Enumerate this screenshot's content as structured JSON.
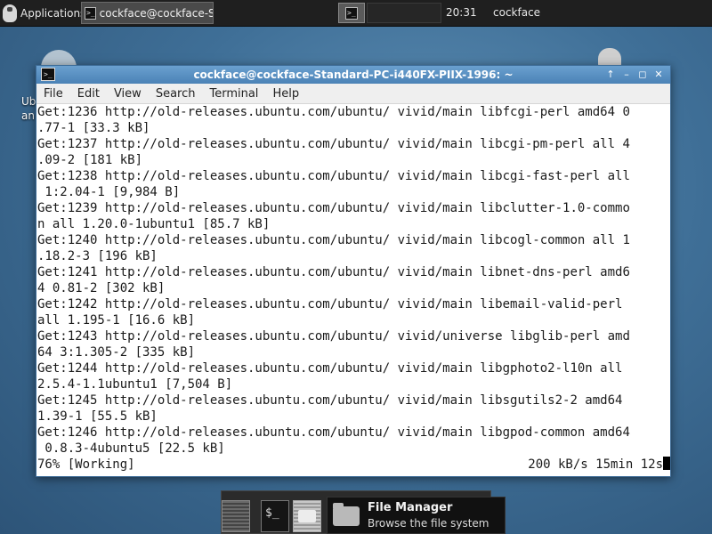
{
  "top_panel": {
    "applications_label": "Applications",
    "task_label": "cockface@cockface-Sta...",
    "clock": "20:31",
    "user": "cockface"
  },
  "desktop": {
    "home_label": "Ub\nan",
    "trash_icon": "trash-icon"
  },
  "window": {
    "title": "cockface@cockface-Standard-PC-i440FX-PIIX-1996: ~",
    "controls": [
      "↑",
      "–",
      "◻",
      "✕"
    ],
    "menu": [
      "File",
      "Edit",
      "View",
      "Search",
      "Terminal",
      "Help"
    ]
  },
  "terminal": {
    "lines": [
      "Get:1236 http://old-releases.ubuntu.com/ubuntu/ vivid/main libfcgi-perl amd64 0",
      ".77-1 [33.3 kB]",
      "Get:1237 http://old-releases.ubuntu.com/ubuntu/ vivid/main libcgi-pm-perl all 4",
      ".09-2 [181 kB]",
      "Get:1238 http://old-releases.ubuntu.com/ubuntu/ vivid/main libcgi-fast-perl all",
      " 1:2.04-1 [9,984 B]",
      "Get:1239 http://old-releases.ubuntu.com/ubuntu/ vivid/main libclutter-1.0-commo",
      "n all 1.20.0-1ubuntu1 [85.7 kB]",
      "Get:1240 http://old-releases.ubuntu.com/ubuntu/ vivid/main libcogl-common all 1",
      ".18.2-3 [196 kB]",
      "Get:1241 http://old-releases.ubuntu.com/ubuntu/ vivid/main libnet-dns-perl amd6",
      "4 0.81-2 [302 kB]",
      "Get:1242 http://old-releases.ubuntu.com/ubuntu/ vivid/main libemail-valid-perl",
      "all 1.195-1 [16.6 kB]",
      "Get:1243 http://old-releases.ubuntu.com/ubuntu/ vivid/universe libglib-perl amd",
      "64 3:1.305-2 [335 kB]",
      "Get:1244 http://old-releases.ubuntu.com/ubuntu/ vivid/main libgphoto2-l10n all",
      "2.5.4-1.1ubuntu1 [7,504 B]",
      "Get:1245 http://old-releases.ubuntu.com/ubuntu/ vivid/main libsgutils2-2 amd64",
      "1.39-1 [55.5 kB]",
      "Get:1246 http://old-releases.ubuntu.com/ubuntu/ vivid/main libgpod-common amd64",
      " 0.8.3-4ubuntu5 [22.5 kB]"
    ],
    "status_left": "76% [Working]",
    "status_right": "200 kB/s 15min 12s"
  },
  "dock": {
    "terminal_glyph": "$_"
  },
  "tooltip": {
    "title": "File Manager",
    "description": "Browse the file system"
  }
}
